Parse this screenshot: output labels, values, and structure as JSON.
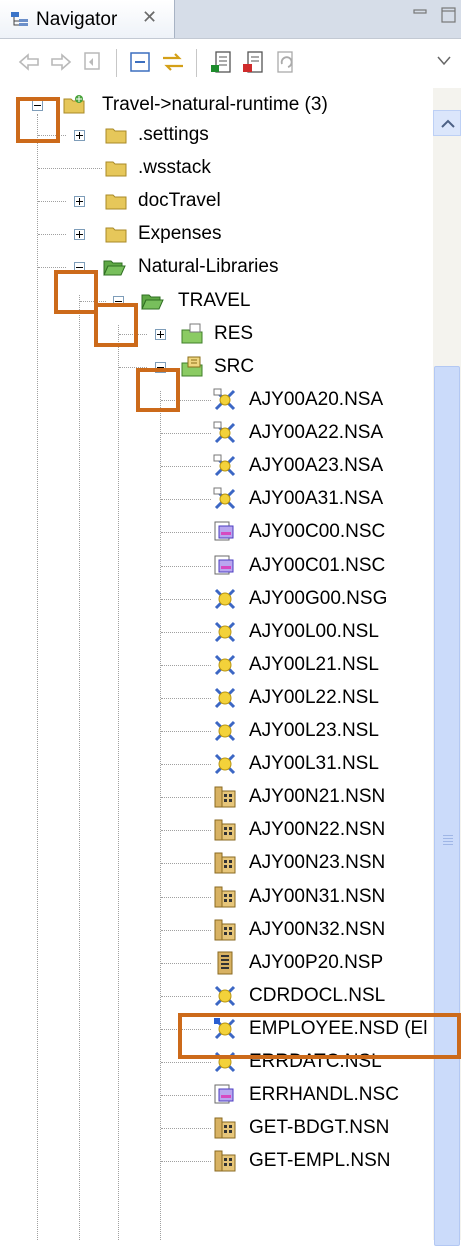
{
  "view": {
    "title": "Navigator"
  },
  "colors": {
    "highlight": "#cc6a1a",
    "folder": "#e2c45c",
    "src_folder": "#4aa12c"
  },
  "toolbar": {
    "buttons": [
      "back-icon",
      "forward-icon",
      "go-into-icon",
      "collapse-all-icon",
      "link-with-editor-icon",
      "natural-library-icon",
      "natural-object-icon",
      "refresh-icon",
      "view-menu-icon"
    ]
  },
  "tree": {
    "root": "Travel->natural-runtime (3)",
    "settings": ".settings",
    "wsstack": ".wsstack",
    "doctravel": "docTravel",
    "expenses": "Expenses",
    "natlibs": "Natural-Libraries",
    "travel": "TRAVEL",
    "res": "RES",
    "src": "SRC",
    "files": [
      {
        "name": "AJY00A20.NSA",
        "icon": "adapter-icon"
      },
      {
        "name": "AJY00A22.NSA",
        "icon": "adapter-icon"
      },
      {
        "name": "AJY00A23.NSA",
        "icon": "adapter-icon"
      },
      {
        "name": "AJY00A31.NSA",
        "icon": "adapter-icon"
      },
      {
        "name": "AJY00C00.NSC",
        "icon": "copycode-icon"
      },
      {
        "name": "AJY00C01.NSC",
        "icon": "copycode-icon"
      },
      {
        "name": "AJY00G00.NSG",
        "icon": "global-data-icon"
      },
      {
        "name": "AJY00L00.NSL",
        "icon": "local-data-icon"
      },
      {
        "name": "AJY00L21.NSL",
        "icon": "local-data-icon"
      },
      {
        "name": "AJY00L22.NSL",
        "icon": "local-data-icon"
      },
      {
        "name": "AJY00L23.NSL",
        "icon": "local-data-icon"
      },
      {
        "name": "AJY00L31.NSL",
        "icon": "local-data-icon"
      },
      {
        "name": "AJY00N21.NSN",
        "icon": "subprogram-icon"
      },
      {
        "name": "AJY00N22.NSN",
        "icon": "subprogram-icon"
      },
      {
        "name": "AJY00N23.NSN",
        "icon": "subprogram-icon"
      },
      {
        "name": "AJY00N31.NSN",
        "icon": "subprogram-icon"
      },
      {
        "name": "AJY00N32.NSN",
        "icon": "subprogram-icon"
      },
      {
        "name": "AJY00P20.NSP",
        "icon": "program-icon"
      },
      {
        "name": "CDRDOCL.NSL",
        "icon": "local-data-icon"
      },
      {
        "name": "EMPLOYEE.NSD (El",
        "icon": "ddm-icon"
      },
      {
        "name": "ERRDATC.NSL",
        "icon": "local-data-icon"
      },
      {
        "name": "ERRHANDL.NSC",
        "icon": "copycode-icon"
      },
      {
        "name": "GET-BDGT.NSN",
        "icon": "subprogram-icon"
      },
      {
        "name": "GET-EMPL.NSN",
        "icon": "subprogram-icon"
      }
    ]
  }
}
